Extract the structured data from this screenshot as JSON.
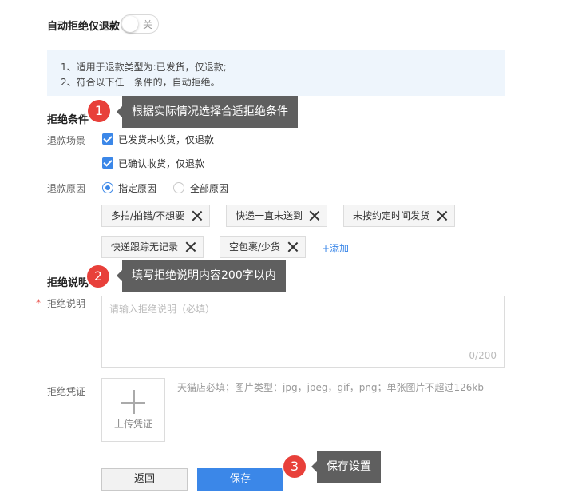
{
  "header": {
    "title": "自动拒绝仅退款",
    "toggle_label": "关"
  },
  "info": {
    "line1": "1、适用于退款类型为:已发货，仅退款;",
    "line2": "2、符合以下任一条件的，自动拒绝。"
  },
  "conditions": {
    "section_title": "拒绝条件",
    "scene_label": "退款场景",
    "scene_options": [
      "已发货未收货，仅退款",
      "已确认收货，仅退款"
    ],
    "reason_label": "退款原因",
    "reason_options": [
      "指定原因",
      "全部原因"
    ],
    "reason_selected": "指定原因",
    "tags": [
      "多拍/拍错/不想要",
      "快递一直未送到",
      "未按约定时间发货",
      "快递跟踪无记录",
      "空包裹/少货"
    ],
    "add_label": "+添加"
  },
  "explanation": {
    "section_title": "拒绝说明",
    "required_mark": "*",
    "field_label": "拒绝说明",
    "placeholder": "请输入拒绝说明（必填）",
    "counter": "0/200",
    "voucher_label": "拒绝凭证",
    "upload_label": "上传凭证",
    "upload_hint": "天猫店必填；图片类型：jpg，jpeg，gif，png；单张图片不超过126kb"
  },
  "actions": {
    "back_label": "返回",
    "save_label": "保存"
  },
  "annotations": [
    {
      "number": "1",
      "text": "根据实际情况选择合适拒绝条件"
    },
    {
      "number": "2",
      "text": "填写拒绝说明内容200字以内"
    },
    {
      "number": "3",
      "text": "保存设置"
    }
  ],
  "colors": {
    "accent": "#3b87e8",
    "badge": "#e8403a",
    "tooltip": "#5f5f5f",
    "info_bg": "#eef5fc"
  }
}
